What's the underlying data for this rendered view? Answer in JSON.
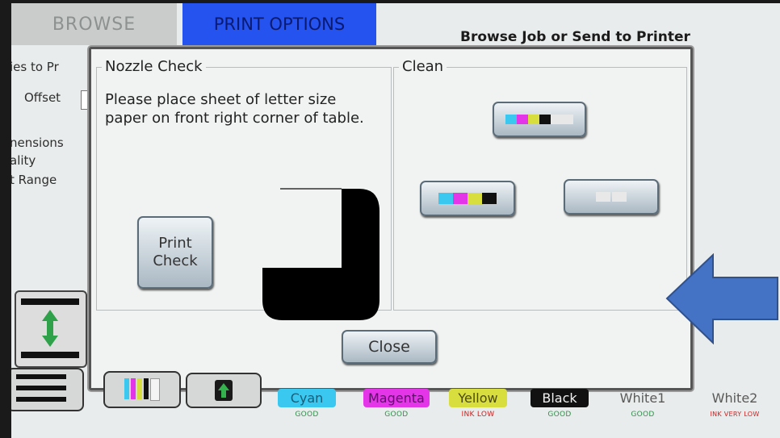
{
  "tabs": {
    "browse": "BROWSE",
    "print_options": "PRINT OPTIONS"
  },
  "header_title": "Browse Job or Send to Printer",
  "background_labels": {
    "copies": "ies to Pr",
    "offset": "Offset",
    "dimensions": "nensions",
    "quality": "ality",
    "range": "t Range"
  },
  "dialog": {
    "nozzle_title": "Nozzle Check",
    "instructions": "Please place sheet of letter size paper on front right corner of table.",
    "print_check_line1": "Print",
    "print_check_line2": "Check",
    "clean_title": "Clean",
    "close_label": "Close"
  },
  "inks": [
    {
      "name": "Cyan",
      "status": "GOOD",
      "color": "#3bc8f0",
      "status_color": "#2f8f4a"
    },
    {
      "name": "Magenta",
      "status": "GOOD",
      "color": "#e535e9",
      "status_color": "#2f8f4a"
    },
    {
      "name": "Yellow",
      "status": "INK LOW",
      "color": "#d9de3f",
      "status_color": "#d42020"
    },
    {
      "name": "Black",
      "status": "GOOD",
      "color": "#111111",
      "status_color": "#2f8f4a"
    },
    {
      "name": "White1",
      "status": "GOOD",
      "color": "#e9ecec",
      "status_color": "#2f8f4a"
    },
    {
      "name": "White2",
      "status": "INK VERY LOW",
      "color": "#e9ecec",
      "status_color": "#d42020"
    }
  ],
  "colors": {
    "cyan": "#3bc8f0",
    "magenta": "#e535e9",
    "yellow": "#d9de3f",
    "black": "#111111",
    "white": "#e8e8e8",
    "arrow_blue": "#4472c4"
  },
  "icons": [
    "corner-shape-icon",
    "cmyk-swatch-icon",
    "white-swatch-icon",
    "up-arrow-icon",
    "menu-icon",
    "ink-levels-icon",
    "blue-pointer-arrow-icon"
  ]
}
